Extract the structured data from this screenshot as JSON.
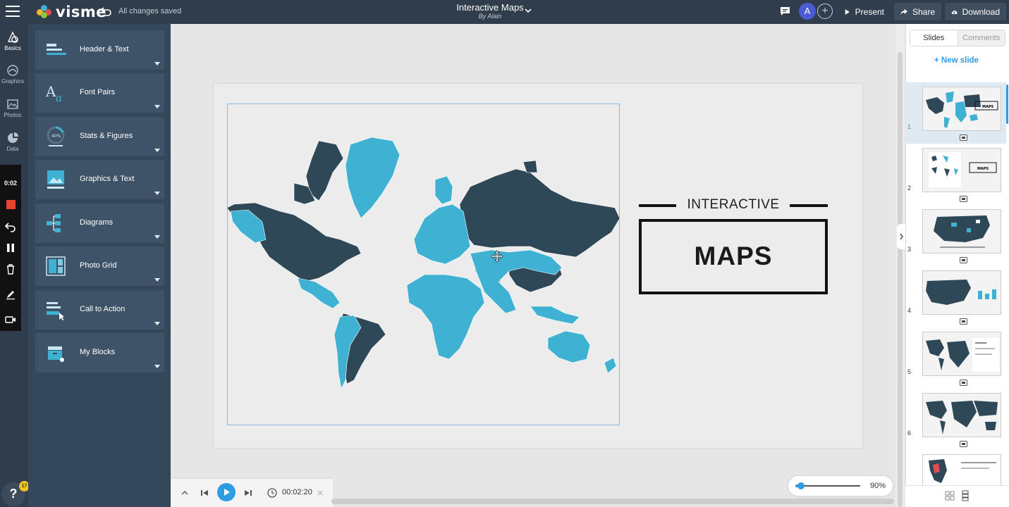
{
  "topbar": {
    "logo_text": "visme",
    "save_status": "All changes saved",
    "doc_title": "Interactive Maps",
    "doc_author": "By Alain",
    "avatar_initial": "A",
    "present_label": "Present",
    "share_label": "Share",
    "download_label": "Download"
  },
  "rail": {
    "items": [
      {
        "label": "Basics",
        "icon": "basics-icon"
      },
      {
        "label": "Graphics",
        "icon": "graphics-icon"
      },
      {
        "label": "Photos",
        "icon": "photos-icon"
      },
      {
        "label": "Data",
        "icon": "data-icon"
      }
    ],
    "recording_time": "0:02",
    "help_label": "?",
    "help_badge": "17"
  },
  "library": {
    "blocks": [
      {
        "label": "Header & Text",
        "icon": "header-text-icon"
      },
      {
        "label": "Font Pairs",
        "icon": "font-pairs-icon"
      },
      {
        "label": "Stats & Figures",
        "icon": "stats-figures-icon"
      },
      {
        "label": "Graphics & Text",
        "icon": "graphics-text-icon"
      },
      {
        "label": "Diagrams",
        "icon": "diagrams-icon"
      },
      {
        "label": "Photo Grid",
        "icon": "photo-grid-icon"
      },
      {
        "label": "Call to Action",
        "icon": "call-to-action-icon"
      },
      {
        "label": "My Blocks",
        "icon": "my-blocks-icon"
      }
    ]
  },
  "slide": {
    "heading_small": "INTERACTIVE",
    "heading_big": "MAPS",
    "map_dark_color": "#2f4858",
    "map_light_color": "#3fb2d4"
  },
  "playback": {
    "time": "00:02:20"
  },
  "zoom": {
    "value_label": "90%",
    "level": 0.9
  },
  "right_panel": {
    "tabs": [
      "Slides",
      "Comments"
    ],
    "active_tab": "Slides",
    "new_slide_label": "+ New slide",
    "slides": [
      {
        "number": "1",
        "active": true
      },
      {
        "number": "2",
        "active": false
      },
      {
        "number": "3",
        "active": false
      },
      {
        "number": "4",
        "active": false
      },
      {
        "number": "5",
        "active": false
      },
      {
        "number": "6",
        "active": false
      }
    ]
  },
  "colors": {
    "topbar_bg": "#2f3d4c",
    "accent": "#2f9be0"
  }
}
